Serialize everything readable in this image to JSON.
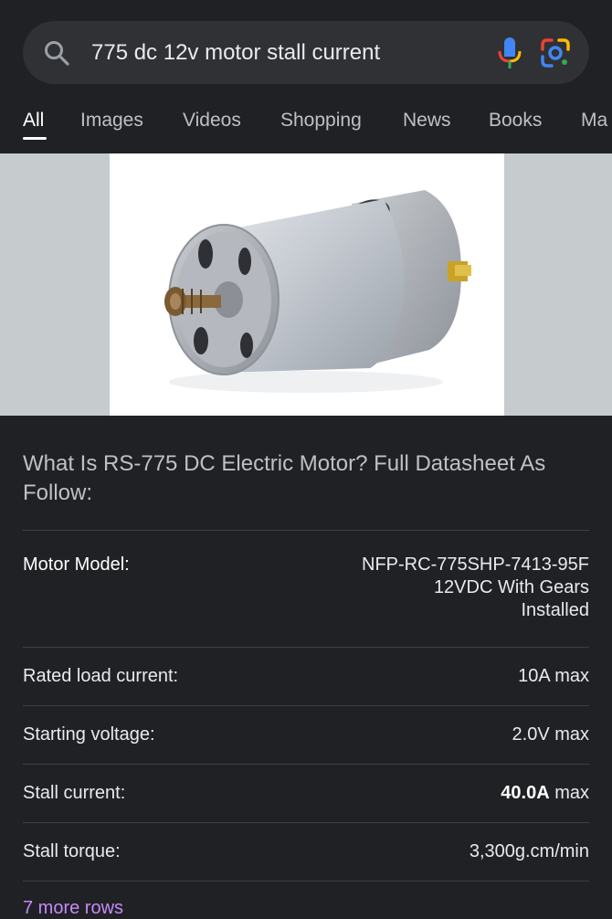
{
  "search": {
    "query": "775 dc 12v motor stall current",
    "icons": [
      "search-icon",
      "microphone-icon",
      "google-lens-icon"
    ]
  },
  "tabs": [
    {
      "label": "All",
      "active": true
    },
    {
      "label": "Images"
    },
    {
      "label": "Videos"
    },
    {
      "label": "Shopping"
    },
    {
      "label": "News"
    },
    {
      "label": "Books"
    },
    {
      "label": "Ma"
    }
  ],
  "result": {
    "title": "What Is RS-775 DC Electric Motor? Full Datasheet As Follow:",
    "table": {
      "header": {
        "label": "Motor Model:",
        "value_lines": [
          "NFP-RC-775SHP-7413-95F",
          "12VDC With Gears",
          "Installed"
        ]
      },
      "rows": [
        {
          "label": "Rated load current:",
          "value": "10A max"
        },
        {
          "label": "Starting voltage:",
          "value": "2.0V max"
        },
        {
          "label": "Stall current:",
          "value_bold": "40.0A",
          "value_suffix": " max"
        },
        {
          "label": "Stall torque:",
          "value": "3,300g.cm/min"
        }
      ]
    },
    "more_rows": "7 more rows"
  },
  "colors": {
    "background": "#202124",
    "search_bg": "#303134",
    "link_purple": "#c58af9"
  }
}
